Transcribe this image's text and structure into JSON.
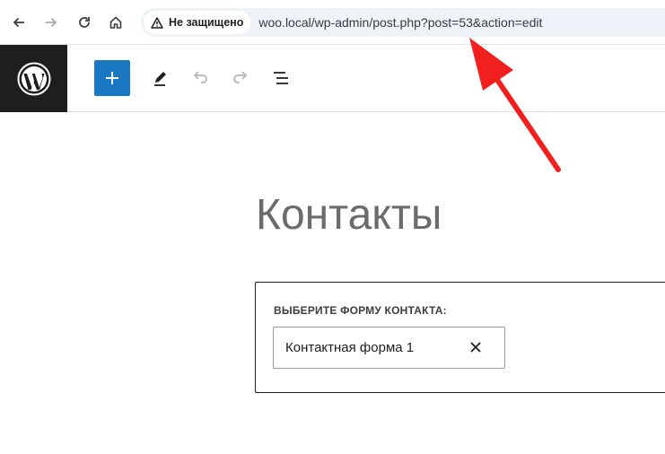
{
  "browser": {
    "security_label": "Не защищено",
    "url": "woo.local/wp-admin/post.php?post=53&action=edit"
  },
  "editor": {
    "post_title": "Контакты",
    "block": {
      "label": "ВЫБЕРИТЕ ФОРМУ КОНТАКТА:",
      "selected_form": "Контактная форма 1"
    }
  },
  "icons": {
    "back": "arrow-left-icon",
    "forward": "arrow-right-icon",
    "reload": "reload-icon",
    "home": "home-icon",
    "warning": "warning-triangle-icon",
    "wp_logo": "wordpress-logo",
    "add": "plus-icon",
    "tools": "pencil-icon",
    "undo": "undo-icon",
    "redo": "redo-icon",
    "outline": "list-view-icon",
    "clear": "close-icon"
  },
  "colors": {
    "accent": "#1a78c2",
    "annotation_arrow": "#f21f1f",
    "wp_logo_bg": "#1e1e1e"
  }
}
